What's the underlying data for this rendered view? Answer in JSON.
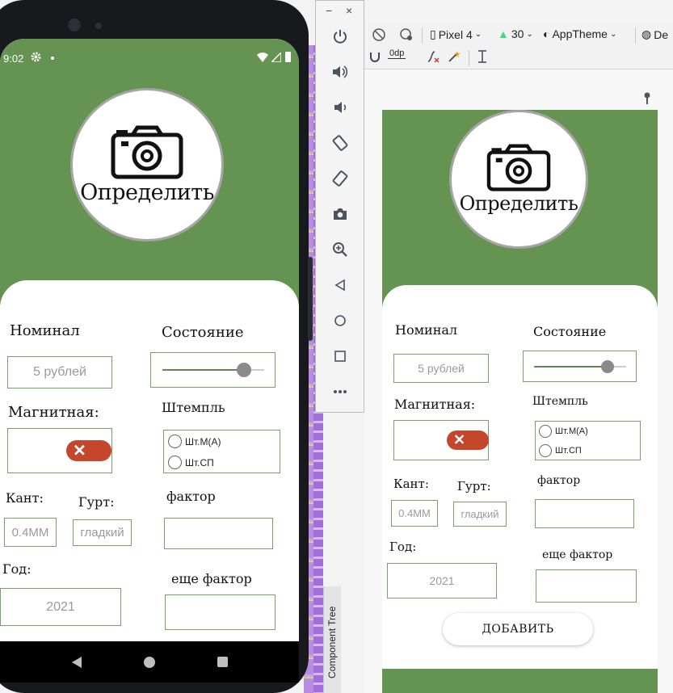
{
  "ide": {
    "toolbar": {
      "device": "Pixel 4",
      "api_level": "30",
      "theme": "AppTheme",
      "locale": "De",
      "dp_value": "0dp"
    },
    "component_tree_label": "Component Tree"
  },
  "emulator_panel": {
    "minimize": "−",
    "close": "×",
    "buttons": [
      "power-icon",
      "volume-up-icon",
      "volume-down-icon",
      "rotate-left-icon",
      "rotate-right-icon",
      "screenshot-icon",
      "zoom-icon",
      "back-icon",
      "home-icon",
      "overview-icon",
      "more-icon"
    ]
  },
  "status_bar": {
    "time": "9:02"
  },
  "app": {
    "detect_label": "Определить",
    "nominal_label": "Номинал",
    "nominal_value": "5 рублей",
    "state_label": "Состояние",
    "state_level_percent": 80,
    "magnetic_label": "Магнитная:",
    "stamp_label": "Штемпль",
    "stamp_options": [
      "Шт.М(А)",
      "Шт.СП"
    ],
    "edge_label": "Кант:",
    "edge_value": "0.4ММ",
    "rim_label": "Гурт:",
    "rim_value": "гладкий",
    "factor_label": "фактор",
    "year_label": "Год:",
    "year_value": "2021",
    "extra_factor_label": "еще фактор",
    "add_button": "ДОБАВИТЬ"
  },
  "colors": {
    "header_green": "#659351",
    "toggle_red": "#c4472b",
    "field_border": "#76a065"
  }
}
